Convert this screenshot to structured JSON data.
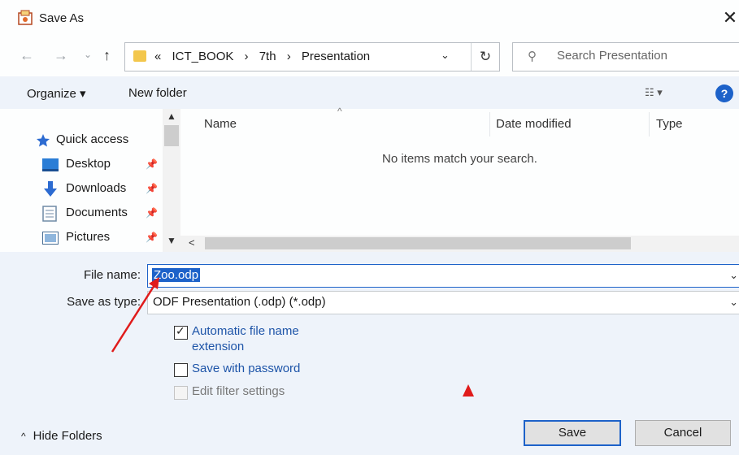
{
  "window": {
    "title": "Save As",
    "close_glyph": "✕",
    "icon": "save-as-icon"
  },
  "nav": {
    "back": "←",
    "forward": "→",
    "recent": "⌄",
    "up": "↑"
  },
  "address": {
    "prefix": "«",
    "crumbs": [
      "ICT_BOOK",
      "7th",
      "Presentation"
    ],
    "separator": "›",
    "dropdown": "⌄",
    "refresh": "↻"
  },
  "search": {
    "placeholder": "Search Presentation",
    "icon": "search-icon"
  },
  "toolbar": {
    "organize_label": "Organize ▾",
    "new_folder_label": "New folder",
    "view_label": "☷ ▾",
    "help_label": "?"
  },
  "nav_pane": {
    "items": [
      {
        "label": "Quick access",
        "icon": "star-icon",
        "color": "#2c6bd1"
      },
      {
        "label": "Desktop",
        "icon": "desktop-icon",
        "pinned": true
      },
      {
        "label": "Downloads",
        "icon": "download-icon",
        "pinned": true
      },
      {
        "label": "Documents",
        "icon": "document-icon",
        "pinned": true
      },
      {
        "label": "Pictures",
        "icon": "pictures-icon",
        "pinned": true
      }
    ],
    "pin_glyph": "📌"
  },
  "file_list": {
    "columns": [
      "Name",
      "Date modified",
      "Type"
    ],
    "empty_message": "No items match your search."
  },
  "form": {
    "file_name_label": "File name:",
    "file_name_value": "Zoo.odp",
    "save_as_type_label": "Save as type:",
    "save_as_type_value": "ODF Presentation (.odp) (*.odp)",
    "options": [
      {
        "label_line1": "Automatic file name",
        "label_line2": "extension",
        "checked": true,
        "enabled": true
      },
      {
        "label_line1": "Save with password",
        "checked": false,
        "enabled": true
      },
      {
        "label_line1": "Edit filter settings",
        "checked": false,
        "enabled": false
      }
    ]
  },
  "footer": {
    "hide_folders_label": "Hide Folders",
    "hide_folders_caret": "^",
    "save_label": "Save",
    "cancel_label": "Cancel"
  },
  "colors": {
    "accent": "#1d62c9",
    "annotation": "#e01b1b",
    "folder": "#f3c74d"
  }
}
